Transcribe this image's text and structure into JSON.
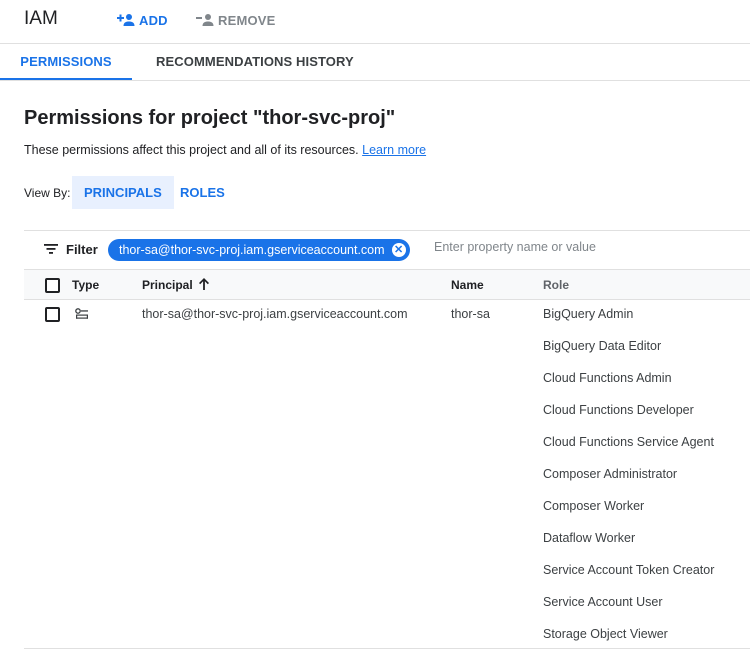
{
  "header": {
    "title": "IAM",
    "add_label": "ADD",
    "remove_label": "REMOVE"
  },
  "tabs": [
    {
      "label": "PERMISSIONS",
      "active": true
    },
    {
      "label": "RECOMMENDATIONS HISTORY",
      "active": false
    }
  ],
  "page": {
    "title": "Permissions for project \"thor-svc-proj\"",
    "description": "These permissions affect this project and all of its resources.",
    "learn_more": "Learn more"
  },
  "view_by": {
    "label": "View By:",
    "options": [
      "PRINCIPALS",
      "ROLES"
    ],
    "selected": "PRINCIPALS"
  },
  "filter": {
    "label": "Filter",
    "chip": "thor-sa@thor-svc-proj.iam.gserviceaccount.com",
    "placeholder": "Enter property name or value"
  },
  "table": {
    "columns": [
      "Type",
      "Principal",
      "Name",
      "Role"
    ],
    "sort_column": "Principal",
    "rows": [
      {
        "type_icon": "service-account-icon",
        "principal": "thor-sa@thor-svc-proj.iam.gserviceaccount.com",
        "name": "thor-sa",
        "roles": [
          "BigQuery Admin",
          "BigQuery Data Editor",
          "Cloud Functions Admin",
          "Cloud Functions Developer",
          "Cloud Functions Service Agent",
          "Composer Administrator",
          "Composer Worker",
          "Dataflow Worker",
          "Service Account Token Creator",
          "Service Account User",
          "Storage Object Viewer"
        ]
      }
    ]
  },
  "colors": {
    "accent": "#1a73e8",
    "selected_bg": "#e8f0fe",
    "header_bg": "#f8f9fa",
    "divider": "#e0e0e0"
  }
}
